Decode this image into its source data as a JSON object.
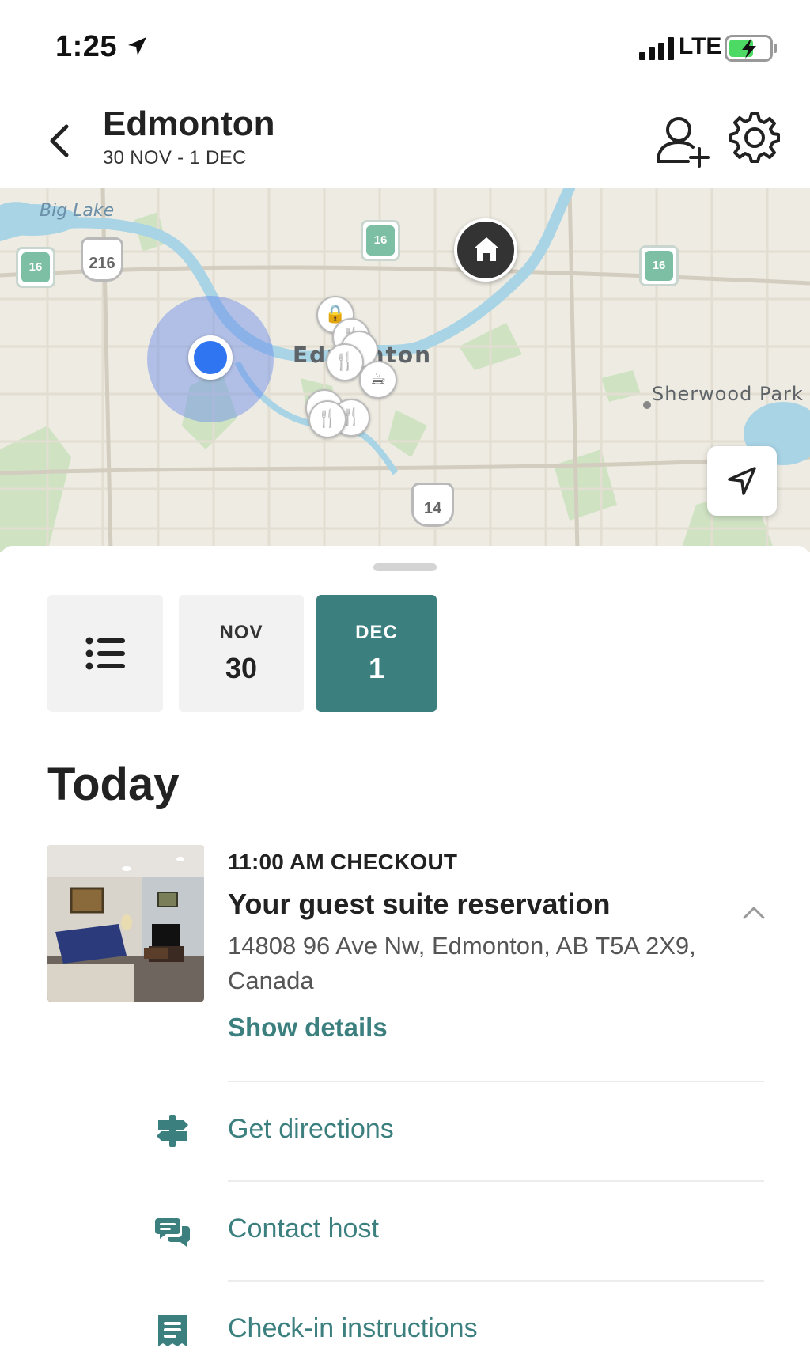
{
  "status_bar": {
    "time": "1:25",
    "network": "LTE"
  },
  "header": {
    "city": "Edmonton",
    "dates": "30 NOV - 1 DEC"
  },
  "map": {
    "labels": {
      "big_lake": "Big Lake",
      "edmonton": "Edmonton",
      "sherwood_park": "Sherwood Park"
    },
    "shields": [
      "16",
      "216",
      "16",
      "16",
      "14"
    ],
    "accent": "#3c7f7f"
  },
  "day_tabs": [
    {
      "month": "",
      "day": ""
    },
    {
      "month": "NOV",
      "day": "30"
    },
    {
      "month": "DEC",
      "day": "1"
    }
  ],
  "section_title": "Today",
  "reservation": {
    "time_label": "11:00 AM CHECKOUT",
    "title": "Your guest suite reservation",
    "address": "14808 96 Ave Nw, Edmonton, AB T5A 2X9, Canada",
    "show_details": "Show details"
  },
  "actions": [
    {
      "label": "Get directions",
      "icon": "signpost-icon"
    },
    {
      "label": "Contact host",
      "icon": "chat-bubbles-icon"
    },
    {
      "label": "Check-in instructions",
      "icon": "document-list-icon"
    }
  ]
}
